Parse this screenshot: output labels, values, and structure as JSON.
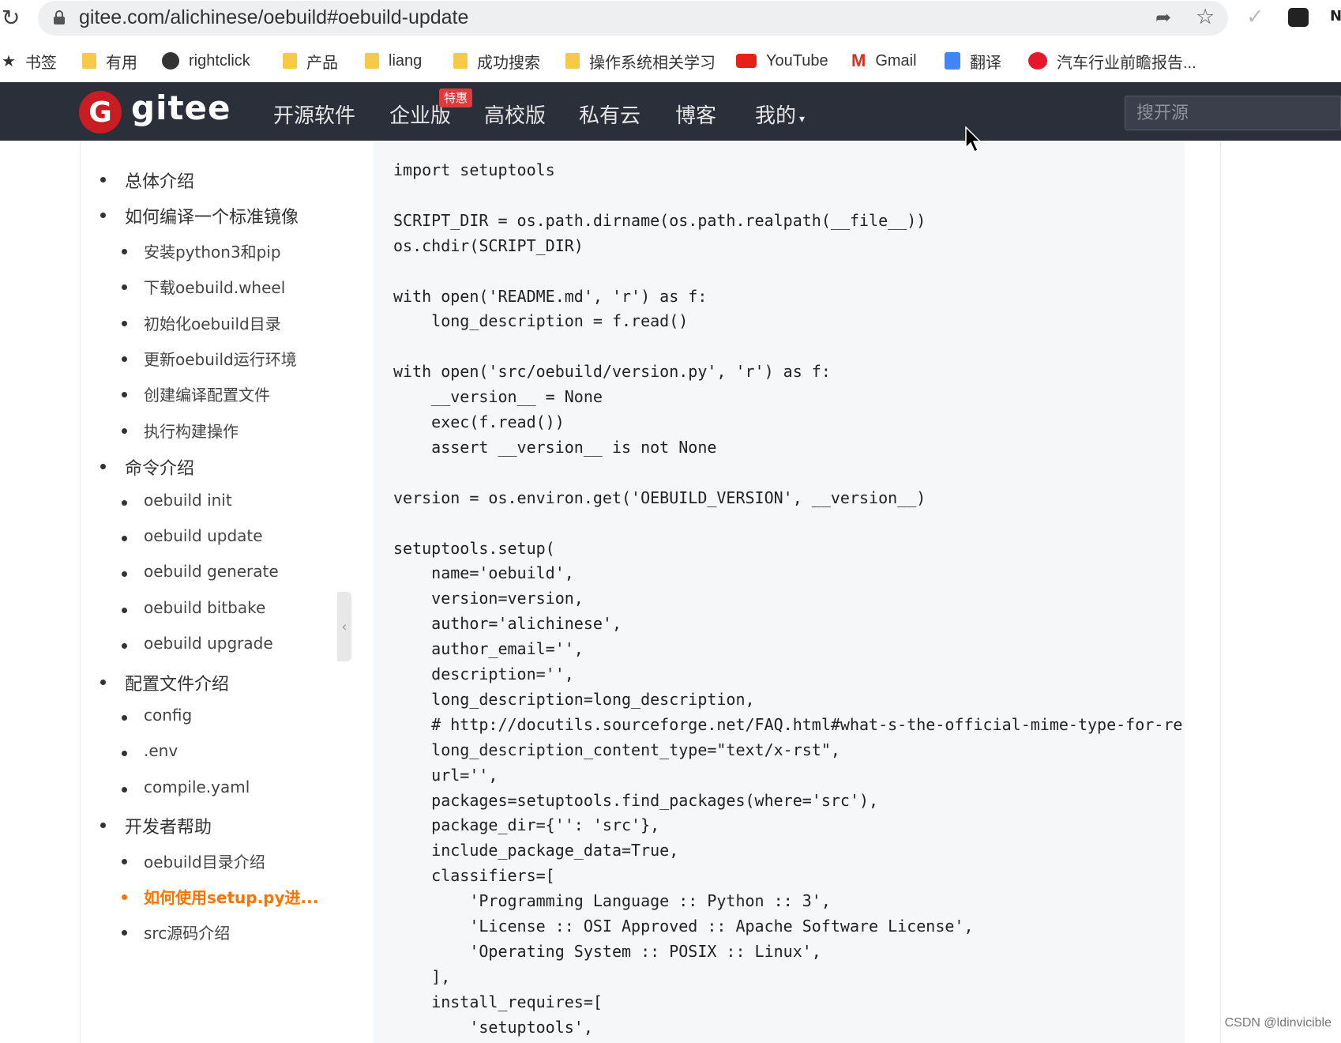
{
  "browser": {
    "url": "gitee.com/alichinese/oebuild#oebuild-update",
    "profile_letter": "N",
    "bookmarks": [
      {
        "label": "书签",
        "icon": "star-icon"
      },
      {
        "label": "有用",
        "icon": "folder-icon"
      },
      {
        "label": "rightclick",
        "icon": "globe-icon"
      },
      {
        "label": "产品",
        "icon": "folder-icon"
      },
      {
        "label": "liang",
        "icon": "folder-icon"
      },
      {
        "label": "成功搜索",
        "icon": "folder-icon"
      },
      {
        "label": "操作系统相关学习",
        "icon": "folder-icon"
      },
      {
        "label": "YouTube",
        "icon": "youtube-icon"
      },
      {
        "label": "Gmail",
        "icon": "gmail-icon"
      },
      {
        "label": "翻译",
        "icon": "translate-icon"
      },
      {
        "label": "汽车行业前瞻报告...",
        "icon": "weibo-icon"
      }
    ]
  },
  "header": {
    "logo_letter": "G",
    "logo_text": "gitee",
    "nav": [
      "开源软件",
      "企业版",
      "高校版",
      "私有云",
      "博客",
      "我的"
    ],
    "badge": "特惠",
    "search_placeholder": "搜开源"
  },
  "toc": [
    {
      "label": "总体介绍",
      "level": 1
    },
    {
      "label": "如何编译一个标准镜像",
      "level": 1
    },
    {
      "label": "安装python3和pip",
      "level": 2
    },
    {
      "label": "下载oebuild.wheel",
      "level": 2
    },
    {
      "label": "初始化oebuild目录",
      "level": 2
    },
    {
      "label": "更新oebuild运行环境",
      "level": 2
    },
    {
      "label": "创建编译配置文件",
      "level": 2
    },
    {
      "label": "执行构建操作",
      "level": 2
    },
    {
      "label": "命令介绍",
      "level": 1
    },
    {
      "label": "oebuild init",
      "level": 2
    },
    {
      "label": "oebuild update",
      "level": 2
    },
    {
      "label": "oebuild generate",
      "level": 2
    },
    {
      "label": "oebuild bitbake",
      "level": 2
    },
    {
      "label": "oebuild upgrade",
      "level": 2
    },
    {
      "label": "配置文件介绍",
      "level": 1
    },
    {
      "label": "config",
      "level": 2
    },
    {
      "label": ".env",
      "level": 2
    },
    {
      "label": "compile.yaml",
      "level": 2
    },
    {
      "label": "开发者帮助",
      "level": 1
    },
    {
      "label": "oebuild目录介绍",
      "level": 2
    },
    {
      "label": "如何使用setup.py进...",
      "level": 2,
      "active": true
    },
    {
      "label": "src源码介绍",
      "level": 2
    }
  ],
  "code_lines": [
    "import setuptools",
    "",
    "SCRIPT_DIR = os.path.dirname(os.path.realpath(__file__))",
    "os.chdir(SCRIPT_DIR)",
    "",
    "with open('README.md', 'r') as f:",
    "    long_description = f.read()",
    "",
    "with open('src/oebuild/version.py', 'r') as f:",
    "    __version__ = None",
    "    exec(f.read())",
    "    assert __version__ is not None",
    "",
    "version = os.environ.get('OEBUILD_VERSION', __version__)",
    "",
    "setuptools.setup(",
    "    name='oebuild',",
    "    version=version,",
    "    author='alichinese',",
    "    author_email='',",
    "    description='',",
    "    long_description=long_description,",
    "    # http://docutils.sourceforge.net/FAQ.html#what-s-the-official-mime-type-for-re",
    "    long_description_content_type=\"text/x-rst\",",
    "    url='',",
    "    packages=setuptools.find_packages(where='src'),",
    "    package_dir={'': 'src'},",
    "    include_package_data=True,",
    "    classifiers=[",
    "        'Programming Language :: Python :: 3',",
    "        'License :: OSI Approved :: Apache Software License',",
    "        'Operating System :: POSIX :: Linux',",
    "    ],",
    "    install_requires=[",
    "        'setuptools',"
  ],
  "watermark": "CSDN @ldinvicible",
  "colors": {
    "header_bg": "#2b2f3a",
    "logo_red": "#c71d23",
    "active_orange": "#fe7300",
    "code_bg": "#f6f7f9"
  }
}
